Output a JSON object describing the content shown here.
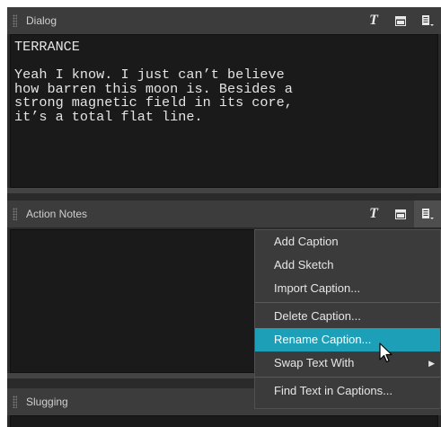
{
  "dialog": {
    "title": "Dialog",
    "lines": [
      "TERRANCE",
      "",
      "Yeah I know. I just can’t believe",
      "how barren this moon is. Besides a",
      "strong magnetic field in its core,",
      "it’s a total flat line."
    ]
  },
  "action_notes": {
    "title": "Action Notes"
  },
  "slugging": {
    "title": "Slugging"
  },
  "header_icons": [
    "text-tool-icon",
    "caption-icon",
    "caption-menu-icon"
  ],
  "context_menu": {
    "items": [
      {
        "label": "Add Caption"
      },
      {
        "label": "Add Sketch"
      },
      {
        "label": "Import Caption..."
      },
      {
        "label": "Delete Caption..."
      },
      {
        "label": "Rename Caption...",
        "highlighted": true
      },
      {
        "label": "Swap Text With",
        "has_submenu": true
      },
      {
        "label": "Find Text in Captions..."
      }
    ]
  },
  "colors": {
    "highlight": "#1d9fb8",
    "panel_bg": "#1a1a1a",
    "header_bg": "#3c3c3c"
  }
}
